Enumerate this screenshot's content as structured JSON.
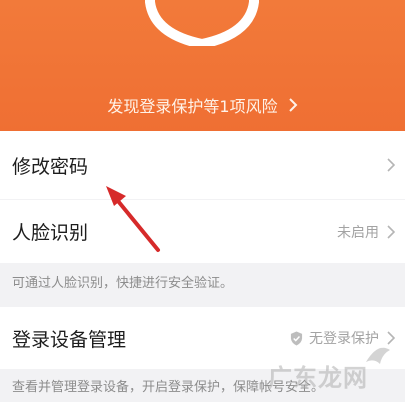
{
  "header": {
    "risk_banner": "发现登录保护等1项风险",
    "bg_color": "#f0713a"
  },
  "rows": {
    "change_password": {
      "label": "修改密码"
    },
    "face_recognition": {
      "label": "人脸识别",
      "status": "未启用"
    },
    "face_hint": "可通过人脸识别，快捷进行安全验证。",
    "device_management": {
      "label": "登录设备管理",
      "status": "无登录保护"
    },
    "device_hint": "查看并管理登录设备，开启登录保护，保障帐号安全。"
  },
  "annotation": {
    "arrow_color": "#d62a2a"
  },
  "watermark": {
    "text": "广东龙网"
  },
  "icons": [
    "shield-icon",
    "chevron-right-icon",
    "shield-check-icon"
  ]
}
